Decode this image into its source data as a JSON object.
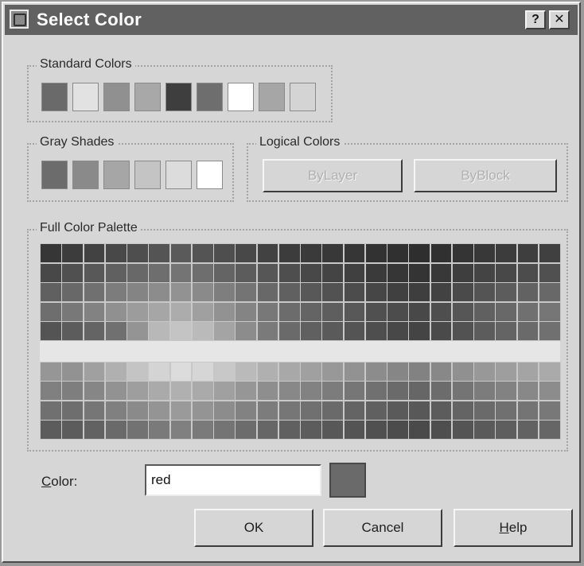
{
  "window": {
    "title": "Select Color",
    "help_btn": "?",
    "close_btn": "✕"
  },
  "standard_colors": {
    "label": "Standard Colors",
    "swatches": [
      "#6a6a6a",
      "#e2e2e2",
      "#909090",
      "#a8a8a8",
      "#3e3e3e",
      "#6e6e6e",
      "#ffffff",
      "#a6a6a6",
      "#d4d4d4"
    ]
  },
  "gray_shades": {
    "label": "Gray Shades",
    "swatches": [
      "#6c6c6c",
      "#8a8a8a",
      "#a6a6a6",
      "#c4c4c4",
      "#dcdcdc",
      "#ffffff"
    ]
  },
  "logical_colors": {
    "label": "Logical Colors",
    "bylayer": "ByLayer",
    "byblock": "ByBlock"
  },
  "palette": {
    "label": "Full Color Palette"
  },
  "color_field": {
    "label_accel": "C",
    "label_rest": "olor:",
    "value": "red",
    "preview_color": "#6a6a6a"
  },
  "buttons": {
    "ok": "OK",
    "cancel": "Cancel",
    "help_accel": "H",
    "help_rest": "elp"
  }
}
